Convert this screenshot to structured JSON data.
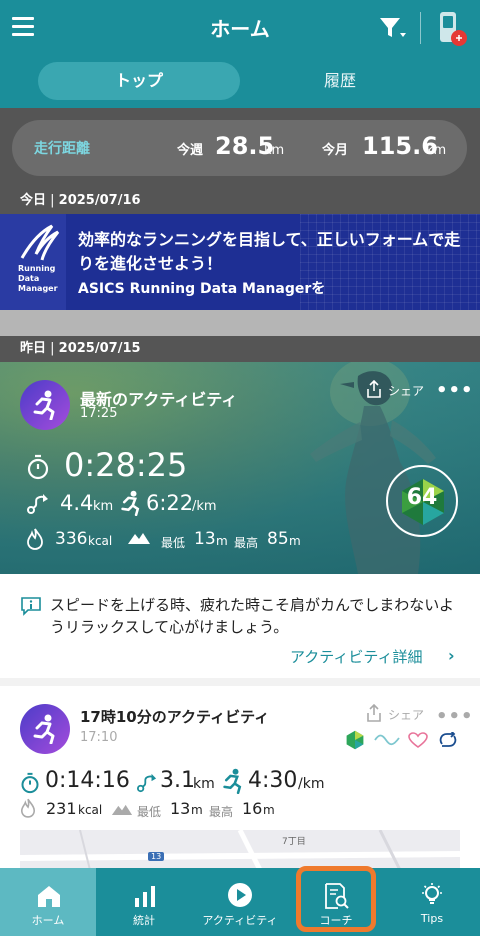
{
  "header": {
    "title": "ホーム"
  },
  "tabs": [
    {
      "label": "トップ"
    },
    {
      "label": "履歴"
    }
  ],
  "summary": {
    "label": "走行距離",
    "week_label": "今週",
    "week_value": "28.5",
    "week_unit": "km",
    "month_label": "今月",
    "month_value": "115.6",
    "month_unit": "km"
  },
  "today": {
    "label": "今日",
    "sep": " | ",
    "date": "2025/07/16"
  },
  "banner": {
    "logo_text": "Running Data Manager",
    "text": "効率的なランニングを目指して、正しいフォームで走りを進化させよう！",
    "subtext": "ASICS Running Data Managerを"
  },
  "yesterday": {
    "label": "昨日",
    "sep": " | ",
    "date": "2025/07/15"
  },
  "latest": {
    "title": "最新のアクティビティ",
    "time": "17:25",
    "share": "シェア",
    "duration": "0:28:25",
    "distance": "4.4",
    "distance_unit": "km",
    "pace": "6:22",
    "pace_unit": "/km",
    "calories": "336",
    "calories_unit": "kcal",
    "elev_min_label": "最低",
    "elev_min": "13",
    "elev_min_unit": "m",
    "elev_max_label": "最高",
    "elev_max": "85",
    "elev_max_unit": "m",
    "score": "64"
  },
  "coach_tip": {
    "text": "スピードを上げる時、疲れた時こそ肩がカんでしまわないようリラックスして心がけましょう。",
    "link": "アクティビティ詳細"
  },
  "activity2": {
    "title": "17時10分のアクティビティ",
    "time": "17:10",
    "share": "シェア",
    "duration": "0:14:16",
    "distance": "3.1",
    "distance_unit": "km",
    "pace": "4:30",
    "pace_unit": "/km",
    "calories": "231",
    "calories_unit": "kcal",
    "elev_min_label": "最低",
    "elev_min": "13",
    "elev_min_unit": "m",
    "elev_max_label": "最高",
    "elev_max": "16",
    "elev_max_unit": "m",
    "map_label": "7丁目",
    "map_road": "13"
  },
  "bottom_nav": [
    {
      "label": "ホーム"
    },
    {
      "label": "統計"
    },
    {
      "label": "アクティビティ"
    },
    {
      "label": "コーチ"
    },
    {
      "label": "Tips"
    }
  ],
  "colors": {
    "primary": "#1b8e9a",
    "accent": "#ef7a2d",
    "banner": "#1e2f94"
  }
}
